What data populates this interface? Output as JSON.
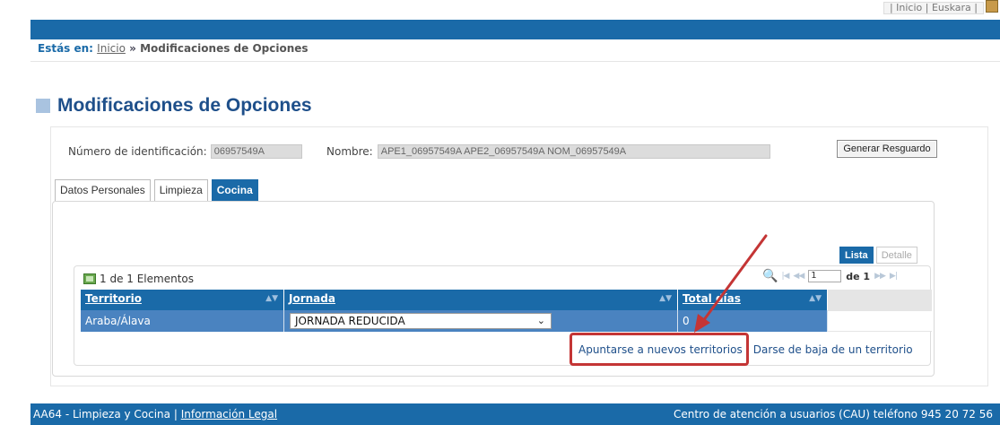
{
  "top": {
    "links": "| Inicio | Euskara |"
  },
  "breadcrumb": {
    "label": "Estás en:",
    "home": "Inicio",
    "separator": "»",
    "current": "Modificaciones de Opciones"
  },
  "page": {
    "title": "Modificaciones de Opciones"
  },
  "identity": {
    "id_label": "Número de identificación:",
    "id_value": "06957549A",
    "name_label": "Nombre:",
    "name_value": "APE1_06957549A APE2_06957549A NOM_06957549A"
  },
  "buttons": {
    "generate": "Generar Resguardo"
  },
  "tabs": [
    {
      "label": "Datos Personales",
      "active": false
    },
    {
      "label": "Limpieza",
      "active": false
    },
    {
      "label": "Cocina",
      "active": true
    }
  ],
  "subtabs": [
    {
      "label": "Lista",
      "active": true
    },
    {
      "label": "Detalle",
      "active": false
    }
  ],
  "grid": {
    "count_text": "1 de 1 Elementos",
    "pager": {
      "page": "1",
      "of_text": "de 1"
    },
    "columns": [
      "Territorio",
      "Jornada",
      "Total días"
    ],
    "rows": [
      {
        "territorio": "Araba/Álava",
        "jornada": "JORNADA REDUCIDA",
        "total": "0"
      }
    ]
  },
  "actions": {
    "join": "Apuntarse a nuevos territorios",
    "separator": "|",
    "leave": "Darse de baja de un territorio"
  },
  "footer": {
    "left_text": "AA64 - Limpieza y Cocina |",
    "legal_link": "Información Legal",
    "right_text": "Centro de atención a usuarios (CAU) teléfono 945 20 72 56"
  },
  "colors": {
    "brand_blue": "#1a6aa8",
    "row_blue": "#4a83c0",
    "highlight_red": "#c43535",
    "title_blue": "#1e4f8a"
  },
  "icons": [
    "magnifier-icon",
    "first-page-icon",
    "prev-page-icon",
    "next-page-icon",
    "last-page-icon",
    "elements-icon",
    "chevron-down-icon",
    "sort-icon"
  ]
}
